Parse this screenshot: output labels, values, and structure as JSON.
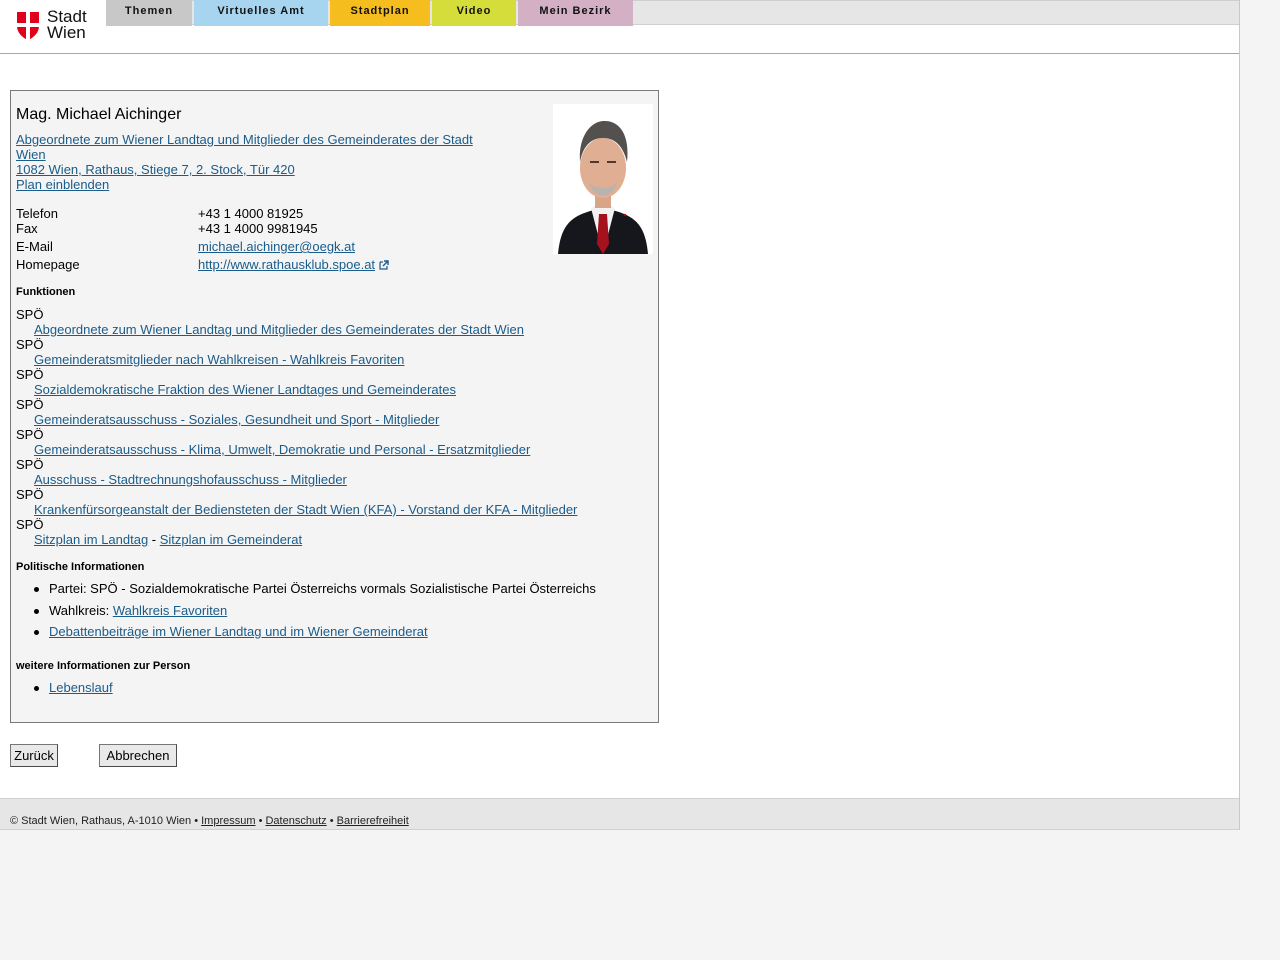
{
  "header": {
    "logo_line1": "Stadt",
    "logo_line2": "Wien",
    "tabs": [
      {
        "label": "Themen",
        "color": "#c8c8c8"
      },
      {
        "label": "Virtuelles Amt",
        "color": "#a7d4ef"
      },
      {
        "label": "Stadtplan",
        "color": "#f6bd1f"
      },
      {
        "label": "Video",
        "color": "#d5dd3a"
      },
      {
        "label": "Mein Bezirk",
        "color": "#d3b0c3"
      }
    ]
  },
  "person": {
    "name": "Mag. Michael Aichinger",
    "group_link_line1": "Abgeordnete zum Wiener Landtag und Mitglieder des Gemeinderates der Stadt",
    "group_link_line2": "Wien",
    "address": "1082 Wien, Rathaus, Stiege 7, 2. Stock, Tür 420",
    "map_link": "Plan einblenden",
    "photo_alt": "portrait-photo"
  },
  "contact": {
    "phone_label": "Telefon",
    "phone": "+43 1 4000 81925",
    "fax_label": "Fax",
    "fax": "+43 1 4000 9981945",
    "email_label": "E-Mail",
    "email": "michael.aichinger@oegk.at",
    "homepage_label": "Homepage",
    "homepage": "http://www.rathausklub.spoe.at"
  },
  "functions": {
    "title": "Funktionen",
    "items": [
      {
        "party": "SPÖ",
        "link": "Abgeordnete zum Wiener Landtag und Mitglieder des Gemeinderates der Stadt Wien"
      },
      {
        "party": "SPÖ",
        "link": "Gemeinderatsmitglieder nach Wahlkreisen - Wahlkreis Favoriten"
      },
      {
        "party": "SPÖ",
        "link": "Sozialdemokratische Fraktion des Wiener Landtages und Gemeinderates"
      },
      {
        "party": "SPÖ",
        "link": "Gemeinderatsausschuss - Soziales, Gesundheit und Sport - Mitglieder"
      },
      {
        "party": "SPÖ",
        "link": "Gemeinderatsausschuss - Klima, Umwelt, Demokratie und Personal - Ersatzmitglieder"
      },
      {
        "party": "SPÖ",
        "link": "Ausschuss - Stadtrechnungshofausschuss - Mitglieder"
      },
      {
        "party": "SPÖ",
        "link": "Krankenfürsorgeanstalt der Bediensteten der Stadt Wien (KFA) - Vorstand der KFA - Mitglieder"
      }
    ],
    "last_party": "SPÖ",
    "seat_landtag": "Sitzplan im Landtag",
    "seat_sep": " - ",
    "seat_gemeinderat": "Sitzplan im Gemeinderat"
  },
  "political": {
    "title": "Politische Informationen",
    "party_text": "Partei: SPÖ - Sozialdemokratische Partei Österreichs vormals Sozialistische Partei Österreichs",
    "district_label": "Wahlkreis: ",
    "district_link": "Wahlkreis Favoriten",
    "debates_link": "Debattenbeiträge im Wiener Landtag und im Wiener Gemeinderat"
  },
  "more": {
    "title": "weitere Informationen zur Person",
    "cv_link": "Lebenslauf"
  },
  "buttons": {
    "back": "Zurück",
    "cancel": "Abbrechen"
  },
  "footer": {
    "copyright": "© Stadt Wien, Rathaus, A-1010 Wien • ",
    "impressum": "Impressum",
    "sep1": " • ",
    "datenschutz": "Datenschutz",
    "sep2": " • ",
    "barrierefreiheit": "Barrierefreiheit"
  }
}
